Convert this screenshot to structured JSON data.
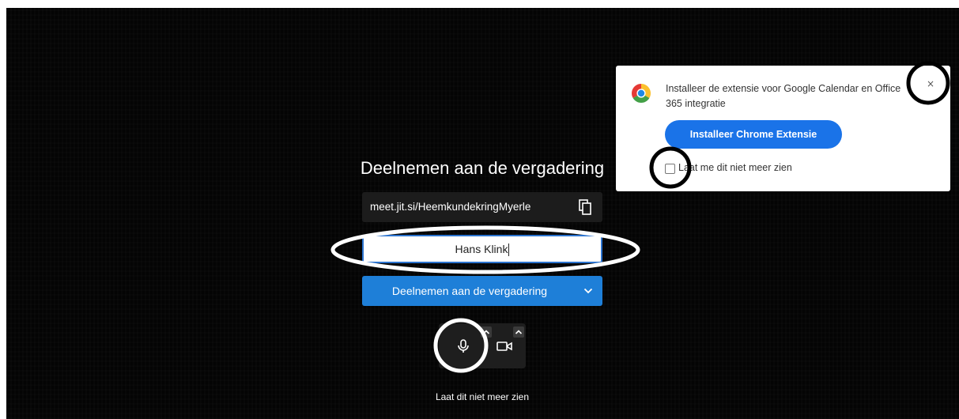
{
  "prejoin": {
    "title": "Deelnemen aan de vergadering",
    "meeting_url": "meet.jit.si/HeemkundekringMyerle",
    "name_value": "Hans Klink",
    "join_button_label": "Deelnemen aan de vergadering",
    "dont_show_again": "Laat dit niet meer zien"
  },
  "extension_popup": {
    "message": "Installeer de extensie voor Google Calendar en Office 365 integratie",
    "install_button_label": "Installeer Chrome Extensie",
    "dont_show_checkbox_label": "Laat me dit niet meer zien",
    "close_glyph": "×",
    "checkbox_checked": false
  },
  "icons": {
    "copy": "copy-icon",
    "join_options": "chevron-down-icon",
    "microphone": "microphone-icon",
    "camera": "camera-icon",
    "audio_settings": "chevron-up-icon",
    "video_settings": "chevron-up-icon",
    "chrome": "chrome-logo-icon",
    "close": "close-icon"
  },
  "colors": {
    "background": "#040404",
    "accent_blue": "#1e7fd8",
    "chrome_button_blue": "#1a73e8",
    "input_focus_border": "#2b73cf",
    "toolbox_bg": "#1e1e1e",
    "annotation_black": "#000000",
    "annotation_white": "#ffffff"
  }
}
